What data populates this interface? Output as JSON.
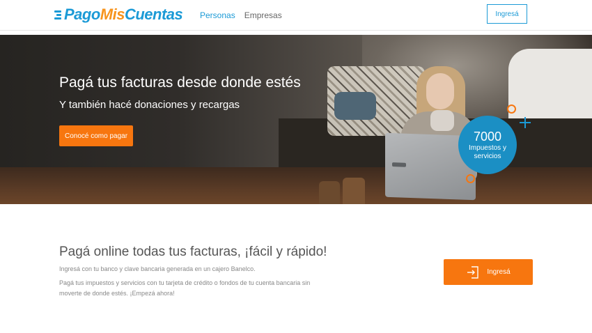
{
  "header": {
    "logo": {
      "part1": "Pago",
      "part2": "Mis",
      "part3": "Cuentas"
    },
    "nav": [
      {
        "label": "Personas",
        "active": true
      },
      {
        "label": "Empresas",
        "active": false
      }
    ],
    "login_label": "Ingresá"
  },
  "hero": {
    "title": "Pagá tus facturas desde donde estés",
    "subtitle": "Y también hacé donaciones y recargas",
    "cta_label": "Conocé como pagar",
    "stat": {
      "number": "7000",
      "label": "Impuestos y servicios"
    }
  },
  "section": {
    "title": "Pagá online todas tus facturas, ¡fácil y rápido!",
    "paragraph1": "Ingresá con tu banco y clave bancaria generada en un cajero Banelco.",
    "paragraph2": "Pagá tus impuestos y servicios con tu tarjeta de crédito o fondos de tu cuenta bancaria sin moverte de donde estés. ¡Empezá ahora!",
    "cta_label": "Ingresá"
  },
  "colors": {
    "brand_blue": "#1b9ad6",
    "brand_orange": "#f7941d",
    "cta_orange": "#f7760f"
  },
  "icons": [
    "logo-mark-icon",
    "plus-icon",
    "ring-icon",
    "login-arrow-icon"
  ]
}
